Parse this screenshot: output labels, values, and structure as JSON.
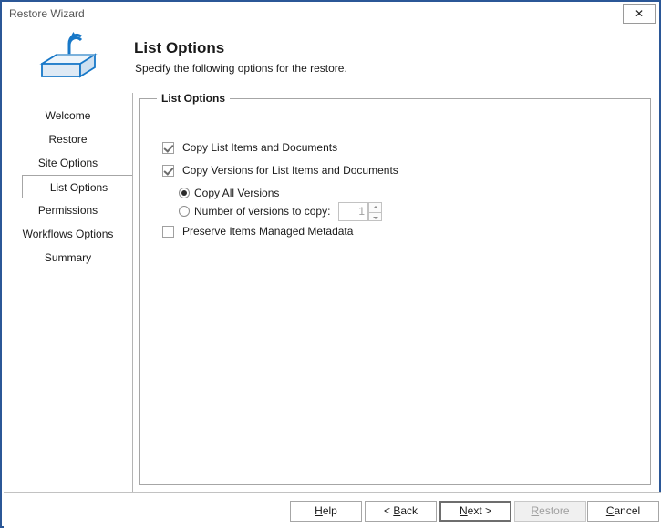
{
  "window": {
    "title": "Restore Wizard",
    "close_label": "✕",
    "icon_name": "restore-box-arrow-icon",
    "border_color": "#2b5797"
  },
  "header": {
    "title": "List Options",
    "subtitle": "Specify the following options for the restore."
  },
  "sidebar": {
    "items": [
      {
        "label": "Welcome",
        "selected": false
      },
      {
        "label": "Restore",
        "selected": false
      },
      {
        "label": "Site Options",
        "selected": false
      },
      {
        "label": "List Options",
        "selected": true
      },
      {
        "label": "Permissions",
        "selected": false
      },
      {
        "label": "Workflows Options",
        "selected": false
      },
      {
        "label": "Summary",
        "selected": false
      }
    ]
  },
  "main": {
    "groupbox_legend": "List Options",
    "checkboxes": [
      {
        "label": "Copy List Items and Documents",
        "checked": true
      },
      {
        "label": "Copy Versions for List Items and  Documents",
        "checked": true
      }
    ],
    "radios": [
      {
        "label": "Copy All Versions",
        "selected": true
      },
      {
        "label": "Number of versions to copy:",
        "selected": false
      }
    ],
    "spinner": {
      "value": "1",
      "disabled": true
    },
    "preserve_checkbox": {
      "label": "Preserve Items Managed Metadata",
      "checked": false
    }
  },
  "footer": {
    "buttons": [
      {
        "label": "Help",
        "mnemonic": "H",
        "state": "normal"
      },
      {
        "label": "< Back",
        "mnemonic": "B",
        "state": "normal"
      },
      {
        "label": "Next >",
        "mnemonic": "N",
        "state": "default"
      },
      {
        "label": "Restore",
        "mnemonic": "R",
        "state": "disabled"
      },
      {
        "label": "Cancel",
        "mnemonic": "C",
        "state": "normal"
      }
    ]
  }
}
